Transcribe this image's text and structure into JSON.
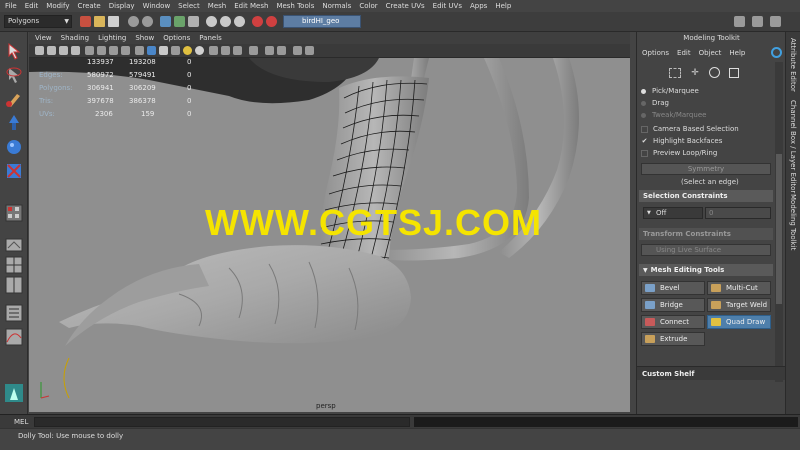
{
  "menubar": [
    "File",
    "Edit",
    "Modify",
    "Create",
    "Display",
    "Window",
    "Select",
    "Mesh",
    "Edit Mesh",
    "Mesh Tools",
    "Normals",
    "Color",
    "Create UVs",
    "Edit UVs",
    "Apps",
    "Help"
  ],
  "shelf": {
    "mode": "Polygons",
    "object_name": "birdHI_geo"
  },
  "viewport": {
    "menus": [
      "View",
      "Shading",
      "Lighting",
      "Show",
      "Options",
      "Panels"
    ],
    "hud": {
      "rows": [
        {
          "label": "",
          "v1": "133937",
          "v2": "193208",
          "v3": "0"
        },
        {
          "label": "Edges:",
          "v1": "580972",
          "v2": "579491",
          "v3": "0"
        },
        {
          "label": "Polygons:",
          "v1": "306941",
          "v2": "306209",
          "v3": "0"
        },
        {
          "label": "Tris:",
          "v1": "397678",
          "v2": "386378",
          "v3": "0"
        },
        {
          "label": "UVs:",
          "v1": "2306",
          "v2": "159",
          "v3": "0"
        }
      ]
    },
    "watermark": "WWW.CGTSJ.COM",
    "camera": "persp"
  },
  "right_tabs": [
    "Attribute Editor",
    "Channel Box / Layer Editor",
    "Modeling Toolkit"
  ],
  "toolkit": {
    "title": "Modeling Toolkit",
    "menus": [
      "Options",
      "Edit",
      "Object",
      "Help"
    ],
    "pick_marquee": "Pick/Marquee",
    "drag": "Drag",
    "tweak_marquee": "Tweak/Marquee",
    "camera_based": "Camera Based Selection",
    "highlight_backfaces": "Highlight Backfaces",
    "preview_loop": "Preview Loop/Ring",
    "symmetry_btn": "Symmetry",
    "select_edge_hint": "(Select an edge)",
    "selection_constraints": "Selection Constraints",
    "constraint_value": "Off",
    "constraint_num": "0",
    "transform_constraints": "Transform Constraints",
    "using_live_surface": "Using Live Surface",
    "mesh_editing_tools": "Mesh Editing Tools",
    "tools": [
      {
        "label": "Bevel",
        "active": false
      },
      {
        "label": "Multi-Cut",
        "active": false
      },
      {
        "label": "Bridge",
        "active": false
      },
      {
        "label": "Target Weld",
        "active": false
      },
      {
        "label": "Connect",
        "active": false
      },
      {
        "label": "Quad Draw",
        "active": true
      },
      {
        "label": "Extrude",
        "active": false
      }
    ],
    "custom_shelf": "Custom Shelf"
  },
  "cmdline": {
    "label": "MEL"
  },
  "help_line": "Dolly Tool: Use mouse to dolly",
  "colors": {
    "viewport_bg": "#8f8f8f",
    "watermark": "#f5e400",
    "active_tool": "#4e7fab",
    "object_field": "#5d7da3"
  }
}
